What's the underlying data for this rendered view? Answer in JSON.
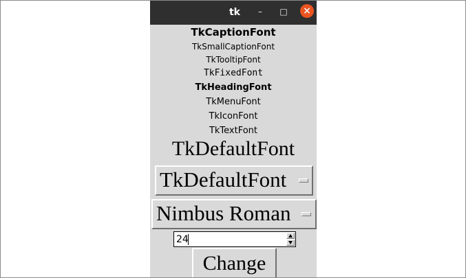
{
  "window": {
    "title": "tk",
    "controls": {
      "minimize": "–",
      "maximize": "□",
      "close": "×"
    }
  },
  "fonts": [
    "TkCaptionFont",
    "TkSmallCaptionFont",
    "TkTooltipFont",
    "TkFixedFont",
    "TkHeadingFont",
    "TkMenuFont",
    "TkIconFont",
    "TkTextFont",
    "TkDefaultFont"
  ],
  "controls": {
    "font_option": "TkDefaultFont",
    "family_option": "Nimbus Roman",
    "size_value": "24",
    "change_button": "Change"
  },
  "icons": {
    "minimize": "minimize-icon",
    "maximize": "maximize-icon",
    "close": "close-icon",
    "dropdown": "option-indicator-icon",
    "spin_up": "spin-up-arrow-icon",
    "spin_down": "spin-down-arrow-icon"
  },
  "colors": {
    "titlebar": "#2f2f2f",
    "window_bg": "#d9d9d9",
    "close_button": "#e95420",
    "text": "#000000",
    "input_bg": "#ffffff"
  }
}
